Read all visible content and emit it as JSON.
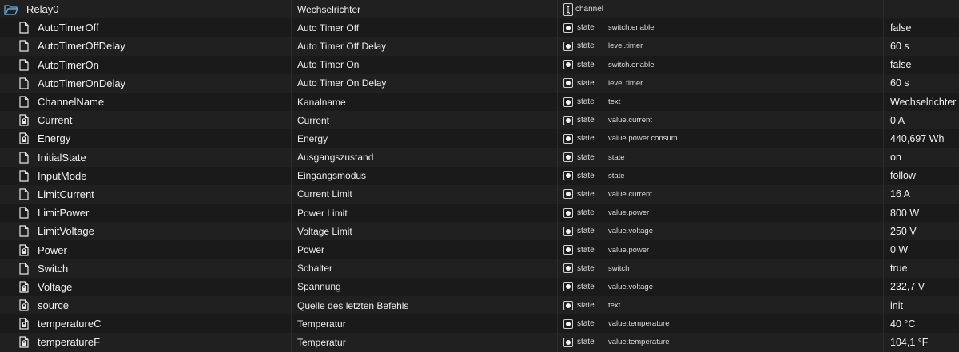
{
  "header": {
    "id": "Relay0",
    "name": "Wechselrichter",
    "type": "channel"
  },
  "rows": [
    {
      "id": "AutoTimerOff",
      "locked": false,
      "name": "Auto Timer Off",
      "type": "state",
      "role": "switch.enable",
      "value": "false"
    },
    {
      "id": "AutoTimerOffDelay",
      "locked": false,
      "name": "Auto Timer Off Delay",
      "type": "state",
      "role": "level.timer",
      "value": "60 s"
    },
    {
      "id": "AutoTimerOn",
      "locked": false,
      "name": "Auto Timer On",
      "type": "state",
      "role": "switch.enable",
      "value": "false"
    },
    {
      "id": "AutoTimerOnDelay",
      "locked": false,
      "name": "Auto Timer On Delay",
      "type": "state",
      "role": "level.timer",
      "value": "60 s"
    },
    {
      "id": "ChannelName",
      "locked": false,
      "name": "Kanalname",
      "type": "state",
      "role": "text",
      "value": "Wechselrichter"
    },
    {
      "id": "Current",
      "locked": true,
      "name": "Current",
      "type": "state",
      "role": "value.current",
      "value": "0 A"
    },
    {
      "id": "Energy",
      "locked": true,
      "name": "Energy",
      "type": "state",
      "role": "value.power.consum...",
      "value": "440,697 Wh"
    },
    {
      "id": "InitialState",
      "locked": false,
      "name": "Ausgangszustand",
      "type": "state",
      "role": "state",
      "value": "on"
    },
    {
      "id": "InputMode",
      "locked": false,
      "name": "Eingangsmodus",
      "type": "state",
      "role": "state",
      "value": "follow"
    },
    {
      "id": "LimitCurrent",
      "locked": false,
      "name": "Current Limit",
      "type": "state",
      "role": "value.current",
      "value": "16 A"
    },
    {
      "id": "LimitPower",
      "locked": false,
      "name": "Power Limit",
      "type": "state",
      "role": "value.power",
      "value": "800 W"
    },
    {
      "id": "LimitVoltage",
      "locked": false,
      "name": "Voltage Limit",
      "type": "state",
      "role": "value.voltage",
      "value": "250 V"
    },
    {
      "id": "Power",
      "locked": true,
      "name": "Power",
      "type": "state",
      "role": "value.power",
      "value": "0 W"
    },
    {
      "id": "Switch",
      "locked": false,
      "name": "Schalter",
      "type": "state",
      "role": "switch",
      "value": "true"
    },
    {
      "id": "Voltage",
      "locked": true,
      "name": "Spannung",
      "type": "state",
      "role": "value.voltage",
      "value": "232,7 V"
    },
    {
      "id": "source",
      "locked": true,
      "name": "Quelle des letzten Befehls",
      "type": "state",
      "role": "text",
      "value": "init"
    },
    {
      "id": "temperatureC",
      "locked": true,
      "name": "Temperatur",
      "type": "state",
      "role": "value.temperature",
      "value": "40 °C"
    },
    {
      "id": "temperatureF",
      "locked": true,
      "name": "Temperatur",
      "type": "state",
      "role": "value.temperature",
      "value": "104,1 °F"
    }
  ]
}
